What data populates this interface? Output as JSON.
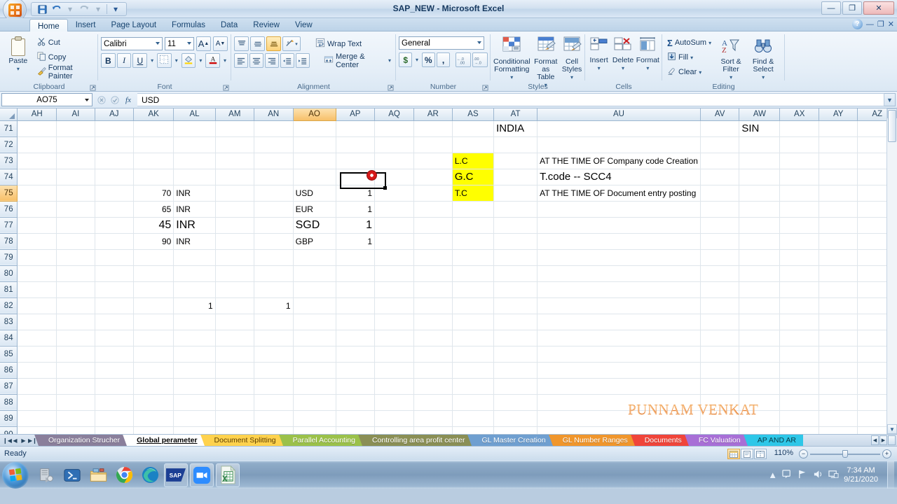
{
  "window": {
    "title": "SAP_NEW - Microsoft Excel",
    "minimize": "—",
    "maximize": "❐",
    "close": "✕",
    "help": "?"
  },
  "quick_access": {
    "save": "💾",
    "undo": "↰",
    "redo": "↱",
    "customize": "▾"
  },
  "ribbon": {
    "tabs": [
      {
        "label": "Home",
        "active": true
      },
      {
        "label": "Insert",
        "active": false
      },
      {
        "label": "Page Layout",
        "active": false
      },
      {
        "label": "Formulas",
        "active": false
      },
      {
        "label": "Data",
        "active": false
      },
      {
        "label": "Review",
        "active": false
      },
      {
        "label": "View",
        "active": false
      }
    ],
    "groups": {
      "clipboard": {
        "name": "Clipboard",
        "paste": "Paste",
        "cut": "Cut",
        "copy": "Copy",
        "format_painter": "Format Painter"
      },
      "font": {
        "name": "Font",
        "font_name": "Calibri",
        "font_size": "11",
        "grow": "A",
        "shrink": "A",
        "bold": "B",
        "italic": "I",
        "underline": "U",
        "borders": "⊞",
        "fill_color": "A",
        "font_color": "A"
      },
      "alignment": {
        "name": "Alignment",
        "wrap_text": "Wrap Text",
        "merge_center": "Merge & Center"
      },
      "number": {
        "name": "Number",
        "format": "General",
        "currency": "$",
        "percent": "%",
        "comma": ",",
        "increase_decimal": "+.0",
        "decrease_decimal": "-.0"
      },
      "styles": {
        "name": "Styles",
        "conditional_formatting": "Conditional Formatting",
        "format_as_table": "Format as Table",
        "cell_styles": "Cell Styles"
      },
      "cells": {
        "name": "Cells",
        "insert": "Insert",
        "delete": "Delete",
        "format": "Format"
      },
      "editing": {
        "name": "Editing",
        "autosum": "AutoSum",
        "fill": "Fill",
        "clear": "Clear",
        "sort_filter": "Sort & Filter",
        "find_select": "Find & Select"
      }
    }
  },
  "formula_bar": {
    "name_box": "AO75",
    "cancel": "✕",
    "enter": "✓",
    "fx": "fx",
    "value": "USD"
  },
  "grid": {
    "columns": [
      "AH",
      "AI",
      "AJ",
      "AK",
      "AL",
      "AM",
      "AN",
      "AO",
      "AP",
      "AQ",
      "AR",
      "AS",
      "AT",
      "AU",
      "AV",
      "AW",
      "AX",
      "AY",
      "AZ"
    ],
    "selected_column": "AO",
    "selected_row": "75",
    "rows": [
      {
        "num": "71",
        "cells": {
          "AT": "INDIA",
          "AW": "SIN"
        }
      },
      {
        "num": "72",
        "cells": {}
      },
      {
        "num": "73",
        "cells": {
          "AS": "L.C",
          "AU": "AT THE TIME OF Company code Creation"
        }
      },
      {
        "num": "74",
        "cells": {
          "AS": "G.C",
          "AU": "T.code -- SCC4"
        }
      },
      {
        "num": "75",
        "cells": {
          "AK": "70",
          "AL": "INR",
          "AO": "USD",
          "AP": "1",
          "AS": "T.C",
          "AU": "AT THE TIME OF Document entry posting"
        }
      },
      {
        "num": "76",
        "cells": {
          "AK": "65",
          "AL": "INR",
          "AO": "EUR",
          "AP": "1"
        }
      },
      {
        "num": "77",
        "cells": {
          "AK": "45",
          "AL": "INR",
          "AO": "SGD",
          "AP": "1"
        }
      },
      {
        "num": "78",
        "cells": {
          "AK": "90",
          "AL": "INR",
          "AO": "GBP",
          "AP": "1"
        }
      },
      {
        "num": "79",
        "cells": {}
      },
      {
        "num": "80",
        "cells": {}
      },
      {
        "num": "81",
        "cells": {}
      },
      {
        "num": "82",
        "cells": {
          "AL": "1",
          "AN": "1"
        }
      },
      {
        "num": "83",
        "cells": {}
      },
      {
        "num": "84",
        "cells": {}
      },
      {
        "num": "85",
        "cells": {}
      },
      {
        "num": "86",
        "cells": {}
      },
      {
        "num": "87",
        "cells": {}
      },
      {
        "num": "88",
        "cells": {}
      },
      {
        "num": "89",
        "cells": {}
      },
      {
        "num": "90",
        "cells": {}
      }
    ],
    "wordart": "PUNNAM VENKAT",
    "highlight_color": "#ffff00",
    "wordart_color": "#e0690f"
  },
  "sheet_tabs": {
    "nav": {
      "first": "❙◀",
      "prev": "◀",
      "next": "▶",
      "last": "▶❙"
    },
    "items": [
      {
        "label": "Organization Strucher",
        "color": "#8a7f9b",
        "active": false
      },
      {
        "label": "Global perameter",
        "color": "#ffffff",
        "active": true
      },
      {
        "label": "Document Splitting",
        "color": "#ffd24d",
        "active": false
      },
      {
        "label": "Parallel Accounting",
        "color": "#9bc14a",
        "active": false
      },
      {
        "label": "Controlling area profit center",
        "color": "#8a8f55",
        "active": false
      },
      {
        "label": "GL Master Creation",
        "color": "#6f9fd0",
        "active": false
      },
      {
        "label": "GL Number Ranges",
        "color": "#f0962c",
        "active": false
      },
      {
        "label": "Documents",
        "color": "#f0453a",
        "active": false
      },
      {
        "label": "FC Valuation",
        "color": "#a86fd6",
        "active": false
      },
      {
        "label": "AP AND AR",
        "color": "#2ec7e8",
        "active": false
      }
    ]
  },
  "status_bar": {
    "state": "Ready",
    "zoom": "110%",
    "views": [
      "normal-view",
      "page-layout-view",
      "page-break-view"
    ],
    "zoom_out": "−",
    "zoom_in": "+"
  },
  "taskbar": {
    "start": "start-orb",
    "items": [
      {
        "name": "server-manager",
        "running": false
      },
      {
        "name": "powershell",
        "running": false
      },
      {
        "name": "file-explorer",
        "running": false
      },
      {
        "name": "google-chrome",
        "running": false
      },
      {
        "name": "microsoft-edge",
        "running": false
      },
      {
        "name": "sap-logon",
        "running": true,
        "label": "SAP"
      },
      {
        "name": "zoom-meetings",
        "running": true
      },
      {
        "name": "microsoft-excel",
        "running": true
      }
    ],
    "tray": {
      "show_hidden": "▲",
      "action_center": "🗨",
      "network": "📶",
      "volume": "🔊",
      "display": "🖥"
    },
    "clock": {
      "time": "7:34 AM",
      "date": "9/21/2020"
    }
  }
}
